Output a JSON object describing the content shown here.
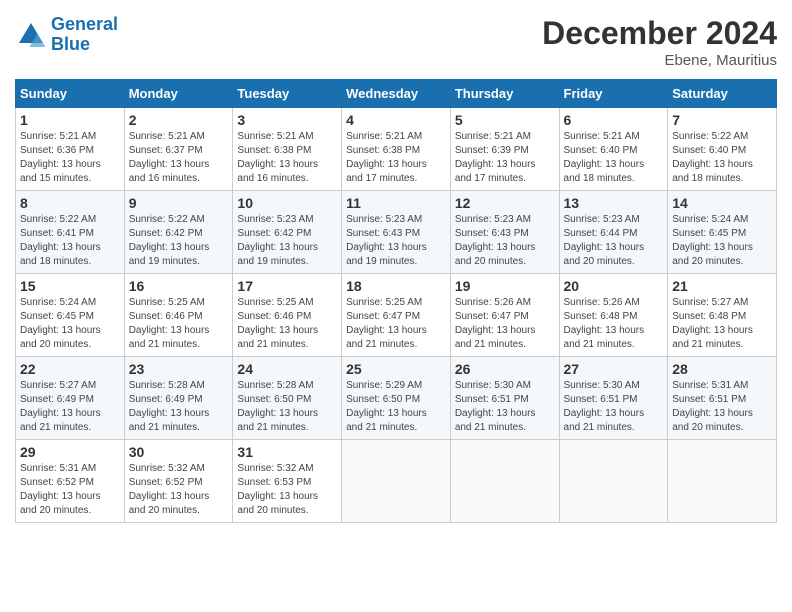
{
  "logo": {
    "line1": "General",
    "line2": "Blue"
  },
  "title": "December 2024",
  "location": "Ebene, Mauritius",
  "days_of_week": [
    "Sunday",
    "Monday",
    "Tuesday",
    "Wednesday",
    "Thursday",
    "Friday",
    "Saturday"
  ],
  "weeks": [
    [
      {
        "day": "1",
        "sunrise": "5:21 AM",
        "sunset": "6:36 PM",
        "daylight": "13 hours and 15 minutes."
      },
      {
        "day": "2",
        "sunrise": "5:21 AM",
        "sunset": "6:37 PM",
        "daylight": "13 hours and 16 minutes."
      },
      {
        "day": "3",
        "sunrise": "5:21 AM",
        "sunset": "6:38 PM",
        "daylight": "13 hours and 16 minutes."
      },
      {
        "day": "4",
        "sunrise": "5:21 AM",
        "sunset": "6:38 PM",
        "daylight": "13 hours and 17 minutes."
      },
      {
        "day": "5",
        "sunrise": "5:21 AM",
        "sunset": "6:39 PM",
        "daylight": "13 hours and 17 minutes."
      },
      {
        "day": "6",
        "sunrise": "5:21 AM",
        "sunset": "6:40 PM",
        "daylight": "13 hours and 18 minutes."
      },
      {
        "day": "7",
        "sunrise": "5:22 AM",
        "sunset": "6:40 PM",
        "daylight": "13 hours and 18 minutes."
      }
    ],
    [
      {
        "day": "8",
        "sunrise": "5:22 AM",
        "sunset": "6:41 PM",
        "daylight": "13 hours and 18 minutes."
      },
      {
        "day": "9",
        "sunrise": "5:22 AM",
        "sunset": "6:42 PM",
        "daylight": "13 hours and 19 minutes."
      },
      {
        "day": "10",
        "sunrise": "5:23 AM",
        "sunset": "6:42 PM",
        "daylight": "13 hours and 19 minutes."
      },
      {
        "day": "11",
        "sunrise": "5:23 AM",
        "sunset": "6:43 PM",
        "daylight": "13 hours and 19 minutes."
      },
      {
        "day": "12",
        "sunrise": "5:23 AM",
        "sunset": "6:43 PM",
        "daylight": "13 hours and 20 minutes."
      },
      {
        "day": "13",
        "sunrise": "5:23 AM",
        "sunset": "6:44 PM",
        "daylight": "13 hours and 20 minutes."
      },
      {
        "day": "14",
        "sunrise": "5:24 AM",
        "sunset": "6:45 PM",
        "daylight": "13 hours and 20 minutes."
      }
    ],
    [
      {
        "day": "15",
        "sunrise": "5:24 AM",
        "sunset": "6:45 PM",
        "daylight": "13 hours and 20 minutes."
      },
      {
        "day": "16",
        "sunrise": "5:25 AM",
        "sunset": "6:46 PM",
        "daylight": "13 hours and 21 minutes."
      },
      {
        "day": "17",
        "sunrise": "5:25 AM",
        "sunset": "6:46 PM",
        "daylight": "13 hours and 21 minutes."
      },
      {
        "day": "18",
        "sunrise": "5:25 AM",
        "sunset": "6:47 PM",
        "daylight": "13 hours and 21 minutes."
      },
      {
        "day": "19",
        "sunrise": "5:26 AM",
        "sunset": "6:47 PM",
        "daylight": "13 hours and 21 minutes."
      },
      {
        "day": "20",
        "sunrise": "5:26 AM",
        "sunset": "6:48 PM",
        "daylight": "13 hours and 21 minutes."
      },
      {
        "day": "21",
        "sunrise": "5:27 AM",
        "sunset": "6:48 PM",
        "daylight": "13 hours and 21 minutes."
      }
    ],
    [
      {
        "day": "22",
        "sunrise": "5:27 AM",
        "sunset": "6:49 PM",
        "daylight": "13 hours and 21 minutes."
      },
      {
        "day": "23",
        "sunrise": "5:28 AM",
        "sunset": "6:49 PM",
        "daylight": "13 hours and 21 minutes."
      },
      {
        "day": "24",
        "sunrise": "5:28 AM",
        "sunset": "6:50 PM",
        "daylight": "13 hours and 21 minutes."
      },
      {
        "day": "25",
        "sunrise": "5:29 AM",
        "sunset": "6:50 PM",
        "daylight": "13 hours and 21 minutes."
      },
      {
        "day": "26",
        "sunrise": "5:30 AM",
        "sunset": "6:51 PM",
        "daylight": "13 hours and 21 minutes."
      },
      {
        "day": "27",
        "sunrise": "5:30 AM",
        "sunset": "6:51 PM",
        "daylight": "13 hours and 21 minutes."
      },
      {
        "day": "28",
        "sunrise": "5:31 AM",
        "sunset": "6:51 PM",
        "daylight": "13 hours and 20 minutes."
      }
    ],
    [
      {
        "day": "29",
        "sunrise": "5:31 AM",
        "sunset": "6:52 PM",
        "daylight": "13 hours and 20 minutes."
      },
      {
        "day": "30",
        "sunrise": "5:32 AM",
        "sunset": "6:52 PM",
        "daylight": "13 hours and 20 minutes."
      },
      {
        "day": "31",
        "sunrise": "5:32 AM",
        "sunset": "6:53 PM",
        "daylight": "13 hours and 20 minutes."
      },
      null,
      null,
      null,
      null
    ]
  ]
}
